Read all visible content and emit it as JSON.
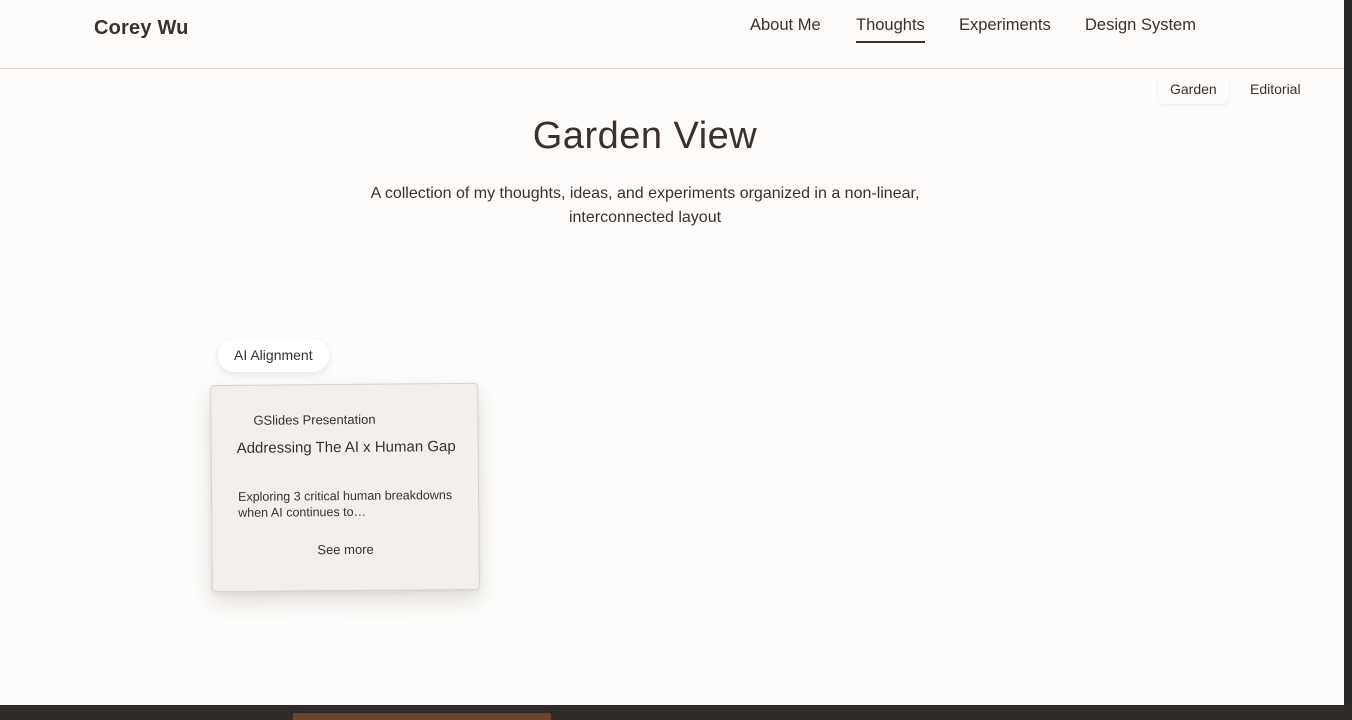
{
  "header": {
    "brand": "Corey Wu",
    "nav": [
      {
        "label": "About Me",
        "active": false
      },
      {
        "label": "Thoughts",
        "active": true
      },
      {
        "label": "Experiments",
        "active": false
      },
      {
        "label": "Design System",
        "active": false
      }
    ]
  },
  "view_toggle": {
    "options": [
      "Garden",
      "Editorial"
    ],
    "selected": "Garden"
  },
  "hero": {
    "title": "Garden View",
    "subtitle": "A collection of my thoughts, ideas, and experiments organized in a non-linear, interconnected layout"
  },
  "garden": {
    "tag": "AI Alignment",
    "card": {
      "type": "GSlides Presentation",
      "title": "Addressing The AI x Human Gap",
      "description": "Exploring 3 critical human breakdowns when AI continues to…",
      "see_more": "See more"
    }
  },
  "colors": {
    "page_bg": "#fdfcfa",
    "text": "#3b302b",
    "card_bg": "#f3f0eb",
    "desktop_bg": "#2a2826"
  }
}
